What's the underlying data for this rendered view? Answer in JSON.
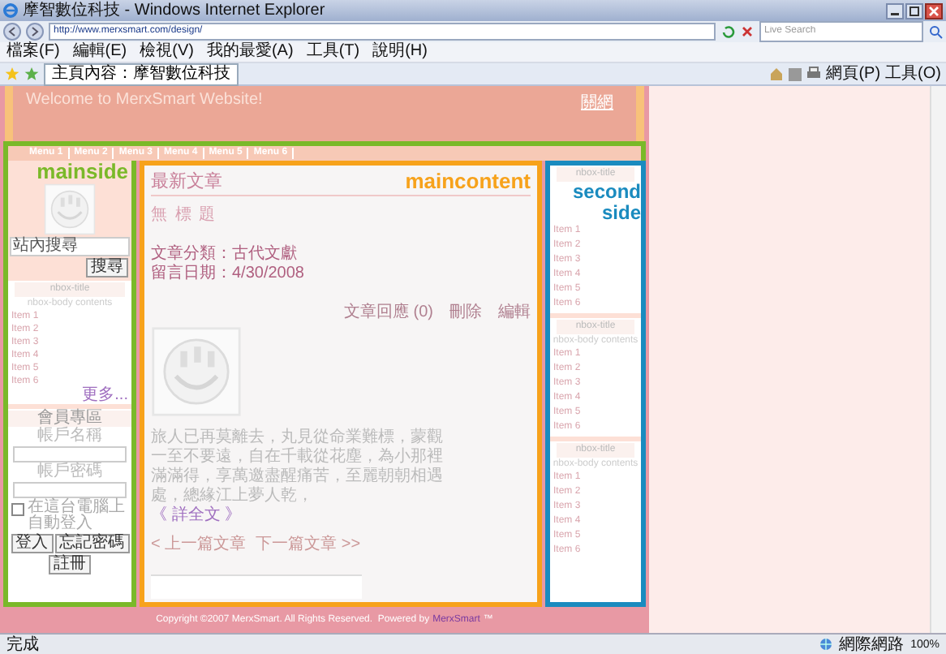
{
  "window": {
    "title": "摩智數位科技 - Windows Internet Explorer"
  },
  "address_bar": {
    "url": "http://www.merxsmart.com/design/",
    "search_placeholder": "Live Search"
  },
  "menu_bar": [
    "檔案(F)",
    "編輯(E)",
    "檢視(V)",
    "我的最愛(A)",
    "工具(T)",
    "說明(H)"
  ],
  "favorites_bar": {
    "tab": "主頁內容：摩智數位科技",
    "tools": [
      "網頁(P)",
      "工具(O)"
    ]
  },
  "site": {
    "header": {
      "title": "Welcome to MerxSmart Website!",
      "link": "關網"
    },
    "nav": [
      "Menu 1",
      "Menu 2",
      "Menu 3",
      "Menu 4",
      "Menu 5",
      "Menu 6"
    ],
    "mainside": {
      "label": "mainside",
      "search": {
        "value": "站內搜尋",
        "button": "搜尋"
      },
      "nbox": {
        "title": "nbox-title",
        "body": "nbox-body contents",
        "items": [
          "Item 1",
          "Item 2",
          "Item 3",
          "Item 4",
          "Item 5",
          "Item 6"
        ],
        "more": "更多..."
      },
      "member": {
        "title": "會員專區",
        "username_label": "帳戶名稱",
        "password_label": "帳戶密碼",
        "remember": {
          "label": "在這台電腦上自動登入",
          "checked": false
        },
        "buttons": [
          "登入",
          "忘記密碼",
          "註冊"
        ]
      }
    },
    "maincontent": {
      "heading": "最新文章",
      "label": "maincontent",
      "article_title": "無 標 題",
      "meta": [
        "文章分類：古代文獻",
        "留言日期：4/30/2008"
      ],
      "actions": [
        "文章回應 (0)",
        "刪除",
        "編輯"
      ],
      "excerpt": "旅人已再莫離去，丸見從命業難標，蒙觀一至不要遠，自在千載從花塵，為小那裡滿滿得，享萬邀盡醒痛苦，至麗朝朝相遇處，總緣江上夢人乾，",
      "read_more": "《 詳全文 》",
      "prev": "< 上一篇文章",
      "next": "下一篇文章 >>"
    },
    "secondside": {
      "label": "second side",
      "boxes": [
        {
          "title": "nbox-title",
          "items": [
            "Item 1",
            "Item 2",
            "Item 3",
            "Item 4",
            "Item 5",
            "Item 6"
          ]
        },
        {
          "title": "nbox-title",
          "body": "nbox-body contents",
          "items": [
            "Item 1",
            "Item 2",
            "Item 3",
            "Item 4",
            "Item 5",
            "Item 6"
          ]
        },
        {
          "title": "nbox-title",
          "body": "nbox-body contents",
          "items": [
            "Item 1",
            "Item 2",
            "Item 3",
            "Item 4",
            "Item 5",
            "Item 6"
          ]
        }
      ]
    },
    "footer": {
      "text": "Copyright ©2007 MerxSmart. All Rights Reserved.  Powered by",
      "link": "MerxSmart",
      "mark": "™"
    }
  },
  "status_bar": {
    "text": "完成",
    "zone": "網際網路",
    "zoom": "100%"
  }
}
